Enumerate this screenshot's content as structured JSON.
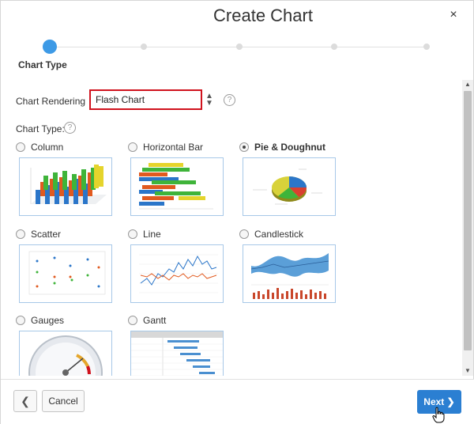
{
  "dialog": {
    "title": "Create Chart",
    "close_glyph": "×"
  },
  "wizard": {
    "current_step_label": "Chart Type",
    "step_count": 6,
    "active_step": 1
  },
  "form": {
    "chart_rendering_label": "Chart Rendering",
    "chart_rendering_value": "Flash Chart",
    "chart_type_label": "Chart Type:",
    "help_glyph": "?"
  },
  "chart_types": [
    {
      "label": "Column",
      "selected": false,
      "icon": "3d-column-chart-icon"
    },
    {
      "label": "Horizontal Bar",
      "selected": false,
      "icon": "3d-horizontal-bar-chart-icon"
    },
    {
      "label": "Pie & Doughnut",
      "selected": true,
      "icon": "pie-chart-icon"
    },
    {
      "label": "Scatter",
      "selected": false,
      "icon": "scatter-chart-icon"
    },
    {
      "label": "Line",
      "selected": false,
      "icon": "line-chart-icon"
    },
    {
      "label": "Candlestick",
      "selected": false,
      "icon": "candlestick-chart-icon"
    },
    {
      "label": "Gauges",
      "selected": false,
      "icon": "gauge-chart-icon"
    },
    {
      "label": "Gantt",
      "selected": false,
      "icon": "gantt-chart-icon"
    }
  ],
  "footer": {
    "back_glyph": "❮",
    "cancel_label": "Cancel",
    "next_label": "Next",
    "next_glyph": "❯"
  },
  "colors": {
    "accent": "#2b7fd2",
    "active_step": "#3d9ae6",
    "error_border": "#d0121d",
    "thumb_border": "#a7c8e8"
  }
}
